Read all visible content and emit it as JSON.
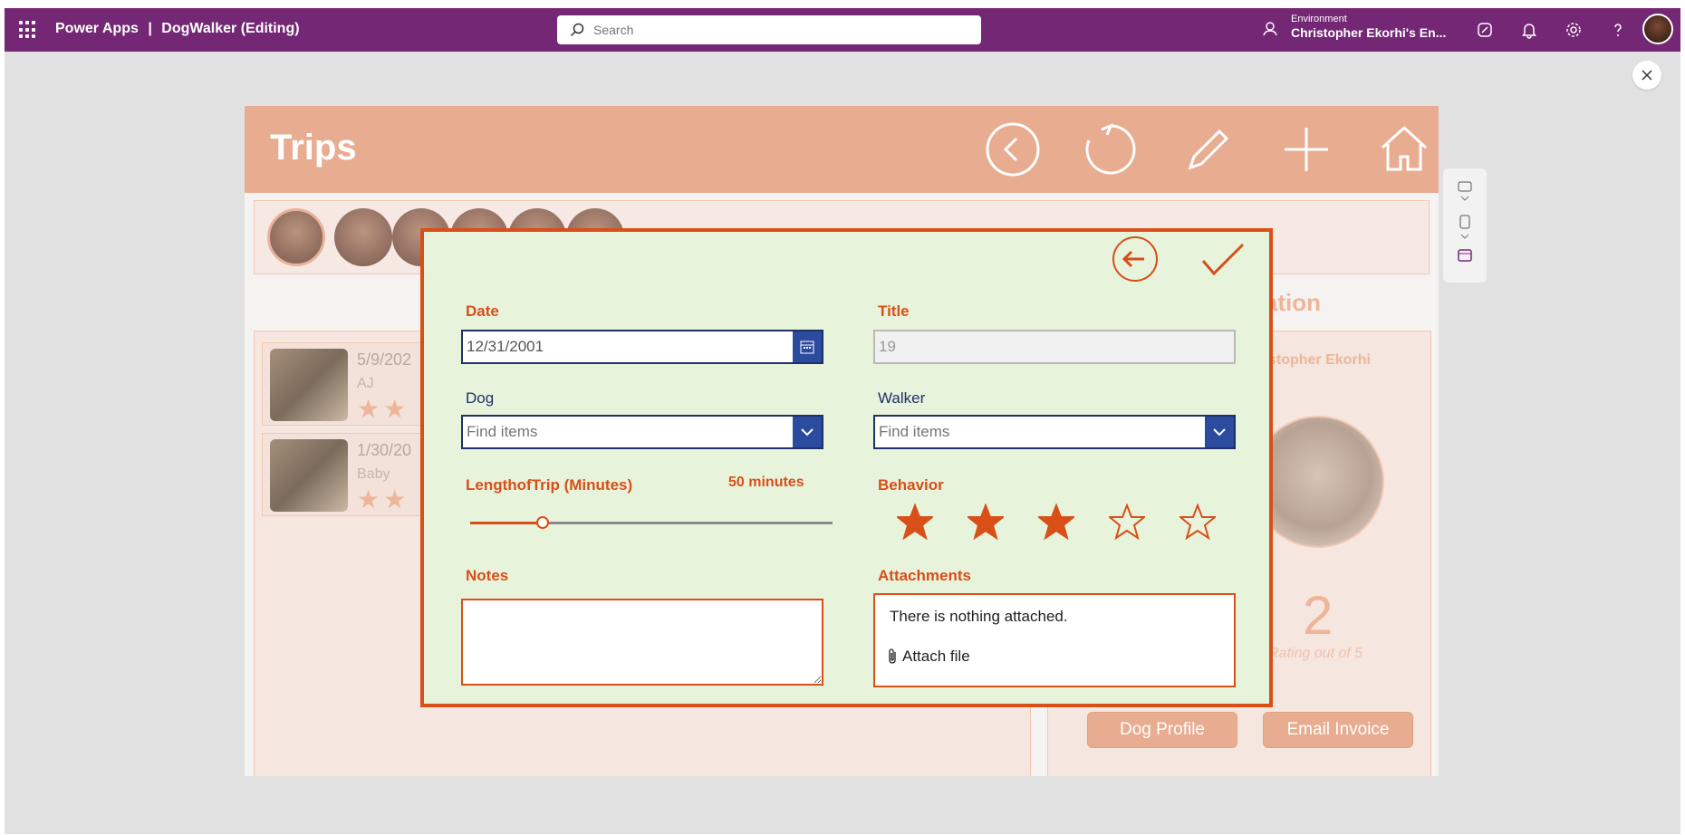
{
  "topbar": {
    "app_name": "Power Apps",
    "separator": "|",
    "app_title": "DogWalker (Editing)",
    "search_placeholder": "Search",
    "environment_label": "Environment",
    "environment_value": "Christopher Ekorhi's En..."
  },
  "app": {
    "header_title": "Trips",
    "trips": [
      {
        "date": "5/9/202",
        "dog": "AJ",
        "stars": "★★"
      },
      {
        "date": "1/30/20",
        "dog": "Baby",
        "stars": "★★"
      }
    ],
    "info_title": "nation",
    "walker_name": "stopher Ekorhi",
    "rating_value": "2",
    "rating_caption": "Rating out of 5",
    "dog_profile_button": "Dog Profile",
    "email_invoice_button": "Email Invoice"
  },
  "dialog": {
    "date_label": "Date",
    "date_value": "12/31/2001",
    "title_label": "Title",
    "title_value": "19",
    "dog_label": "Dog",
    "dog_placeholder": "Find items",
    "walker_label": "Walker",
    "walker_placeholder": "Find items",
    "length_label": "LengthofTrip (Minutes)",
    "length_value_text": "50 minutes",
    "length_fraction": 0.2,
    "behavior_label": "Behavior",
    "behavior_rating": 3,
    "behavior_max": 5,
    "notes_label": "Notes",
    "attachments_label": "Attachments",
    "attachments_empty": "There is nothing attached.",
    "attach_file": "Attach file"
  },
  "colors": {
    "topbar": "#742774",
    "header": "#e8ad91",
    "accent": "#d84f18",
    "navy": "#1f2f6a",
    "dialog_bg": "#e8f3dc"
  }
}
